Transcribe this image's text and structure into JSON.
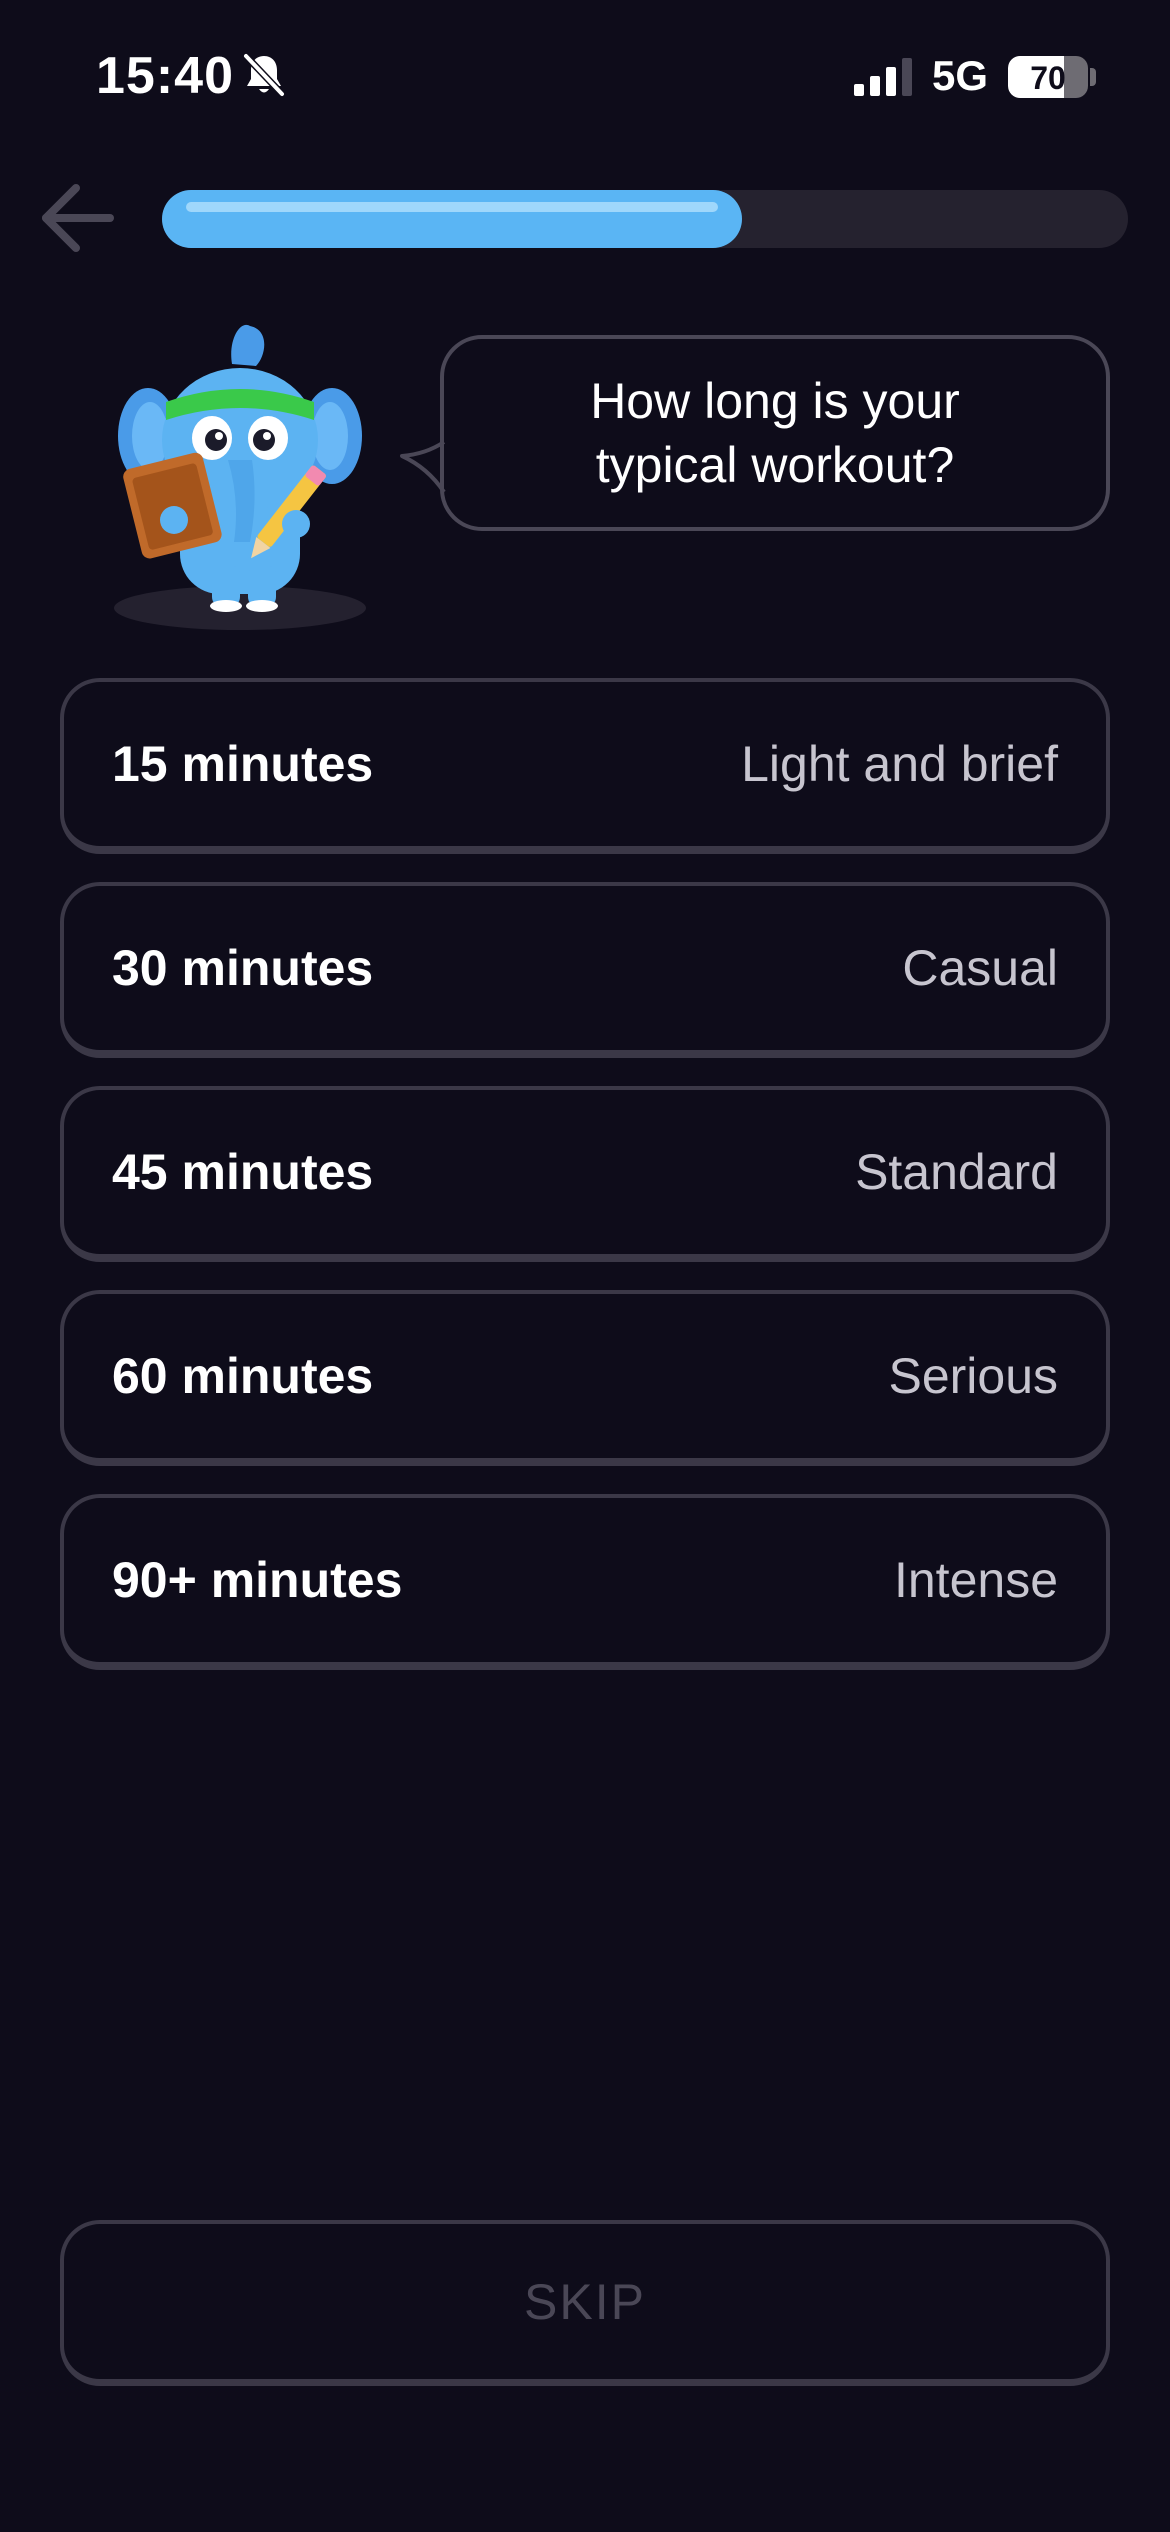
{
  "status_bar": {
    "time": "15:40",
    "network": "5G",
    "battery_level": "70",
    "battery_fraction": 0.7,
    "icons": [
      "bell-slash-icon",
      "signal-icon"
    ]
  },
  "header": {
    "back_icon": "arrow-left-icon",
    "progress_fraction": 0.6
  },
  "question": {
    "text": "How long is your typical workout?"
  },
  "options": [
    {
      "title": "15 minutes",
      "description": "Light and brief"
    },
    {
      "title": "30 minutes",
      "description": "Casual"
    },
    {
      "title": "45 minutes",
      "description": "Standard"
    },
    {
      "title": "60 minutes",
      "description": "Serious"
    },
    {
      "title": "90+ minutes",
      "description": "Intense"
    }
  ],
  "footer": {
    "skip_label": "SKIP"
  },
  "colors": {
    "background": "#0e0c1a",
    "accent": "#5ab5f4",
    "border": "#3b3847",
    "muted_text": "#c7c5cf"
  }
}
